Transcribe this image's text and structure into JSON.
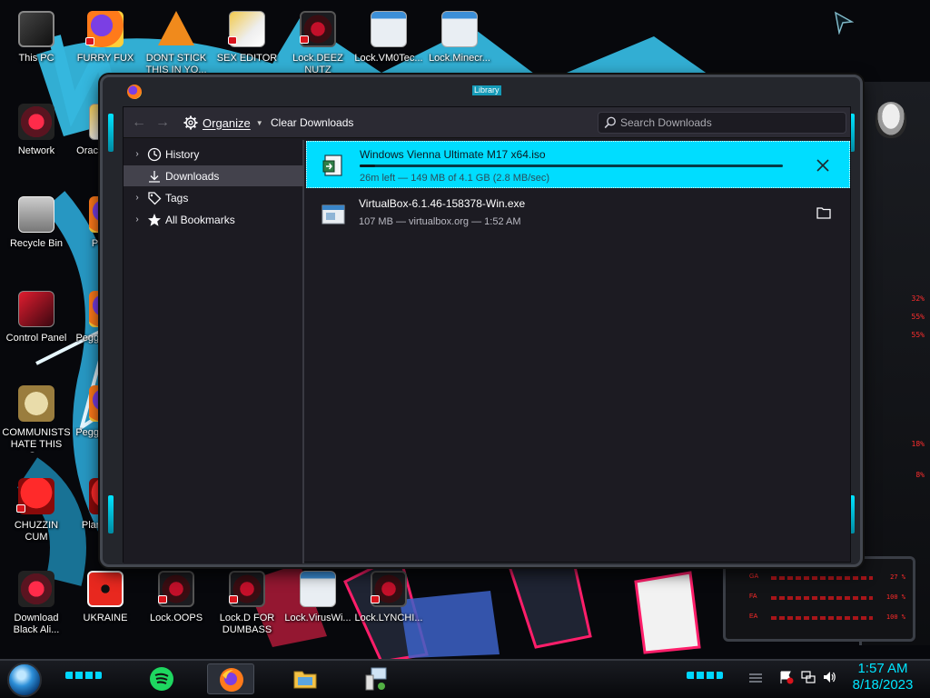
{
  "desktop": {
    "icons_left": [
      {
        "label": "This PC"
      },
      {
        "label": "Network"
      },
      {
        "label": "Recycle Bin"
      },
      {
        "label": "Control Panel"
      },
      {
        "label": "COMMUNISTS HATE THIS G..."
      },
      {
        "label": "CHUZZIN CUM"
      },
      {
        "label": "Download Black Ali..."
      }
    ],
    "icons_top": [
      {
        "label": "FURRY FUX"
      },
      {
        "label": "DONT STICK THIS IN YO..."
      },
      {
        "label": "SEX EDITOR"
      },
      {
        "label": "Lock.DEEZ NUTZ"
      },
      {
        "label": "Lock.VM0Tec..."
      },
      {
        "label": "Lock.Minecr..."
      }
    ],
    "icons_col2": [
      {
        "label": "Orac... Virtu..."
      },
      {
        "label": "Peggle"
      },
      {
        "label": "Peggle Delu..."
      },
      {
        "label": "Peggle of War"
      },
      {
        "label": "Plan Zom..."
      }
    ],
    "icons_bottom": [
      {
        "label": "UKRAINE"
      },
      {
        "label": "Lock.OOPS"
      },
      {
        "label": "Lock.D FOR DUMBASS"
      },
      {
        "label": "Lock.VirusWi..."
      },
      {
        "label": "Lock.LYNCHI..."
      }
    ]
  },
  "gauges": {
    "values": [
      "32%",
      "55%",
      "55%",
      "18%",
      "8%"
    ]
  },
  "bars": [
    {
      "label": "GA",
      "value": "27 %"
    },
    {
      "label": "FA",
      "value": "100 %"
    },
    {
      "label": "EA",
      "value": "100 %"
    }
  ],
  "window": {
    "title": "Library",
    "toolbar": {
      "organize_label": "Organize",
      "clear_label": "Clear Downloads",
      "search_placeholder": "Search Downloads"
    },
    "sidebar": [
      {
        "label": "History",
        "icon": "clock-icon"
      },
      {
        "label": "Downloads",
        "icon": "download-icon"
      },
      {
        "label": "Tags",
        "icon": "tag-icon"
      },
      {
        "label": "All Bookmarks",
        "icon": "star-icon"
      }
    ],
    "downloads": [
      {
        "name": "Windows Vienna Ultimate M17 x64.iso",
        "status": "26m left — 149 MB of 4.1 GB (2.8 MB/sec)",
        "progress": 0.036,
        "action": "cancel"
      },
      {
        "name": "VirtualBox-6.1.46-158378-Win.exe",
        "status": "107 MB — virtualbox.org — 1:52 AM",
        "action": "open-folder"
      }
    ]
  },
  "taskbar": {
    "time": "1:57 AM",
    "date": "8/18/2023"
  },
  "colors": {
    "accent": "#00ddff",
    "window_bg": "#1c1b22",
    "clock": "#00e5ff"
  }
}
